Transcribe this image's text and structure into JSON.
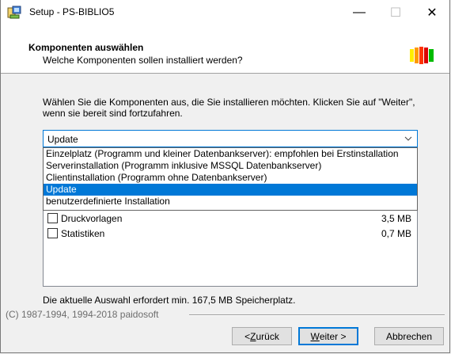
{
  "window": {
    "title": "Setup - PS-BIBLIO5",
    "minimize_glyph": "—",
    "maximize_glyph": "☐",
    "close_glyph": "✕"
  },
  "header": {
    "title": "Komponenten auswählen",
    "subtitle": "Welche Komponenten sollen installiert werden?",
    "bar_colors": [
      "#ffee00",
      "#ff9900",
      "#ff3300",
      "#dd0000",
      "#00bb00"
    ]
  },
  "instructions": "Wählen Sie die Komponenten aus, die Sie installieren möchten. Klicken Sie auf \"Weiter\", wenn sie bereit sind fortzufahren.",
  "setup_type": {
    "selected": "Update",
    "options": [
      "Einzelplatz (Programm und kleiner Datenbankserver): empfohlen bei Erstinstallation",
      "Serverinstallation (Programm inklusive MSSQL Datenbankserver)",
      "Clientinstallation (Programm ohne Datenbankserver)",
      "Update",
      "benutzerdefinierte Installation"
    ],
    "highlighted_index": 3
  },
  "components": [
    {
      "label": "Druckvorlagen",
      "size": "3,5 MB",
      "checked": false
    },
    {
      "label": "Statistiken",
      "size": "0,7 MB",
      "checked": false
    }
  ],
  "space_required": "Die aktuelle Auswahl erfordert min. 167,5 MB Speicherplatz.",
  "copyright": "(C) 1987-1994, 1994-2018 paidosoft",
  "buttons": {
    "back_pre": "< ",
    "back_acc": "Z",
    "back_post": "urück",
    "next_acc": "W",
    "next_post": "eiter >",
    "cancel": "Abbrechen"
  },
  "colors": {
    "accent": "#0078d7"
  }
}
